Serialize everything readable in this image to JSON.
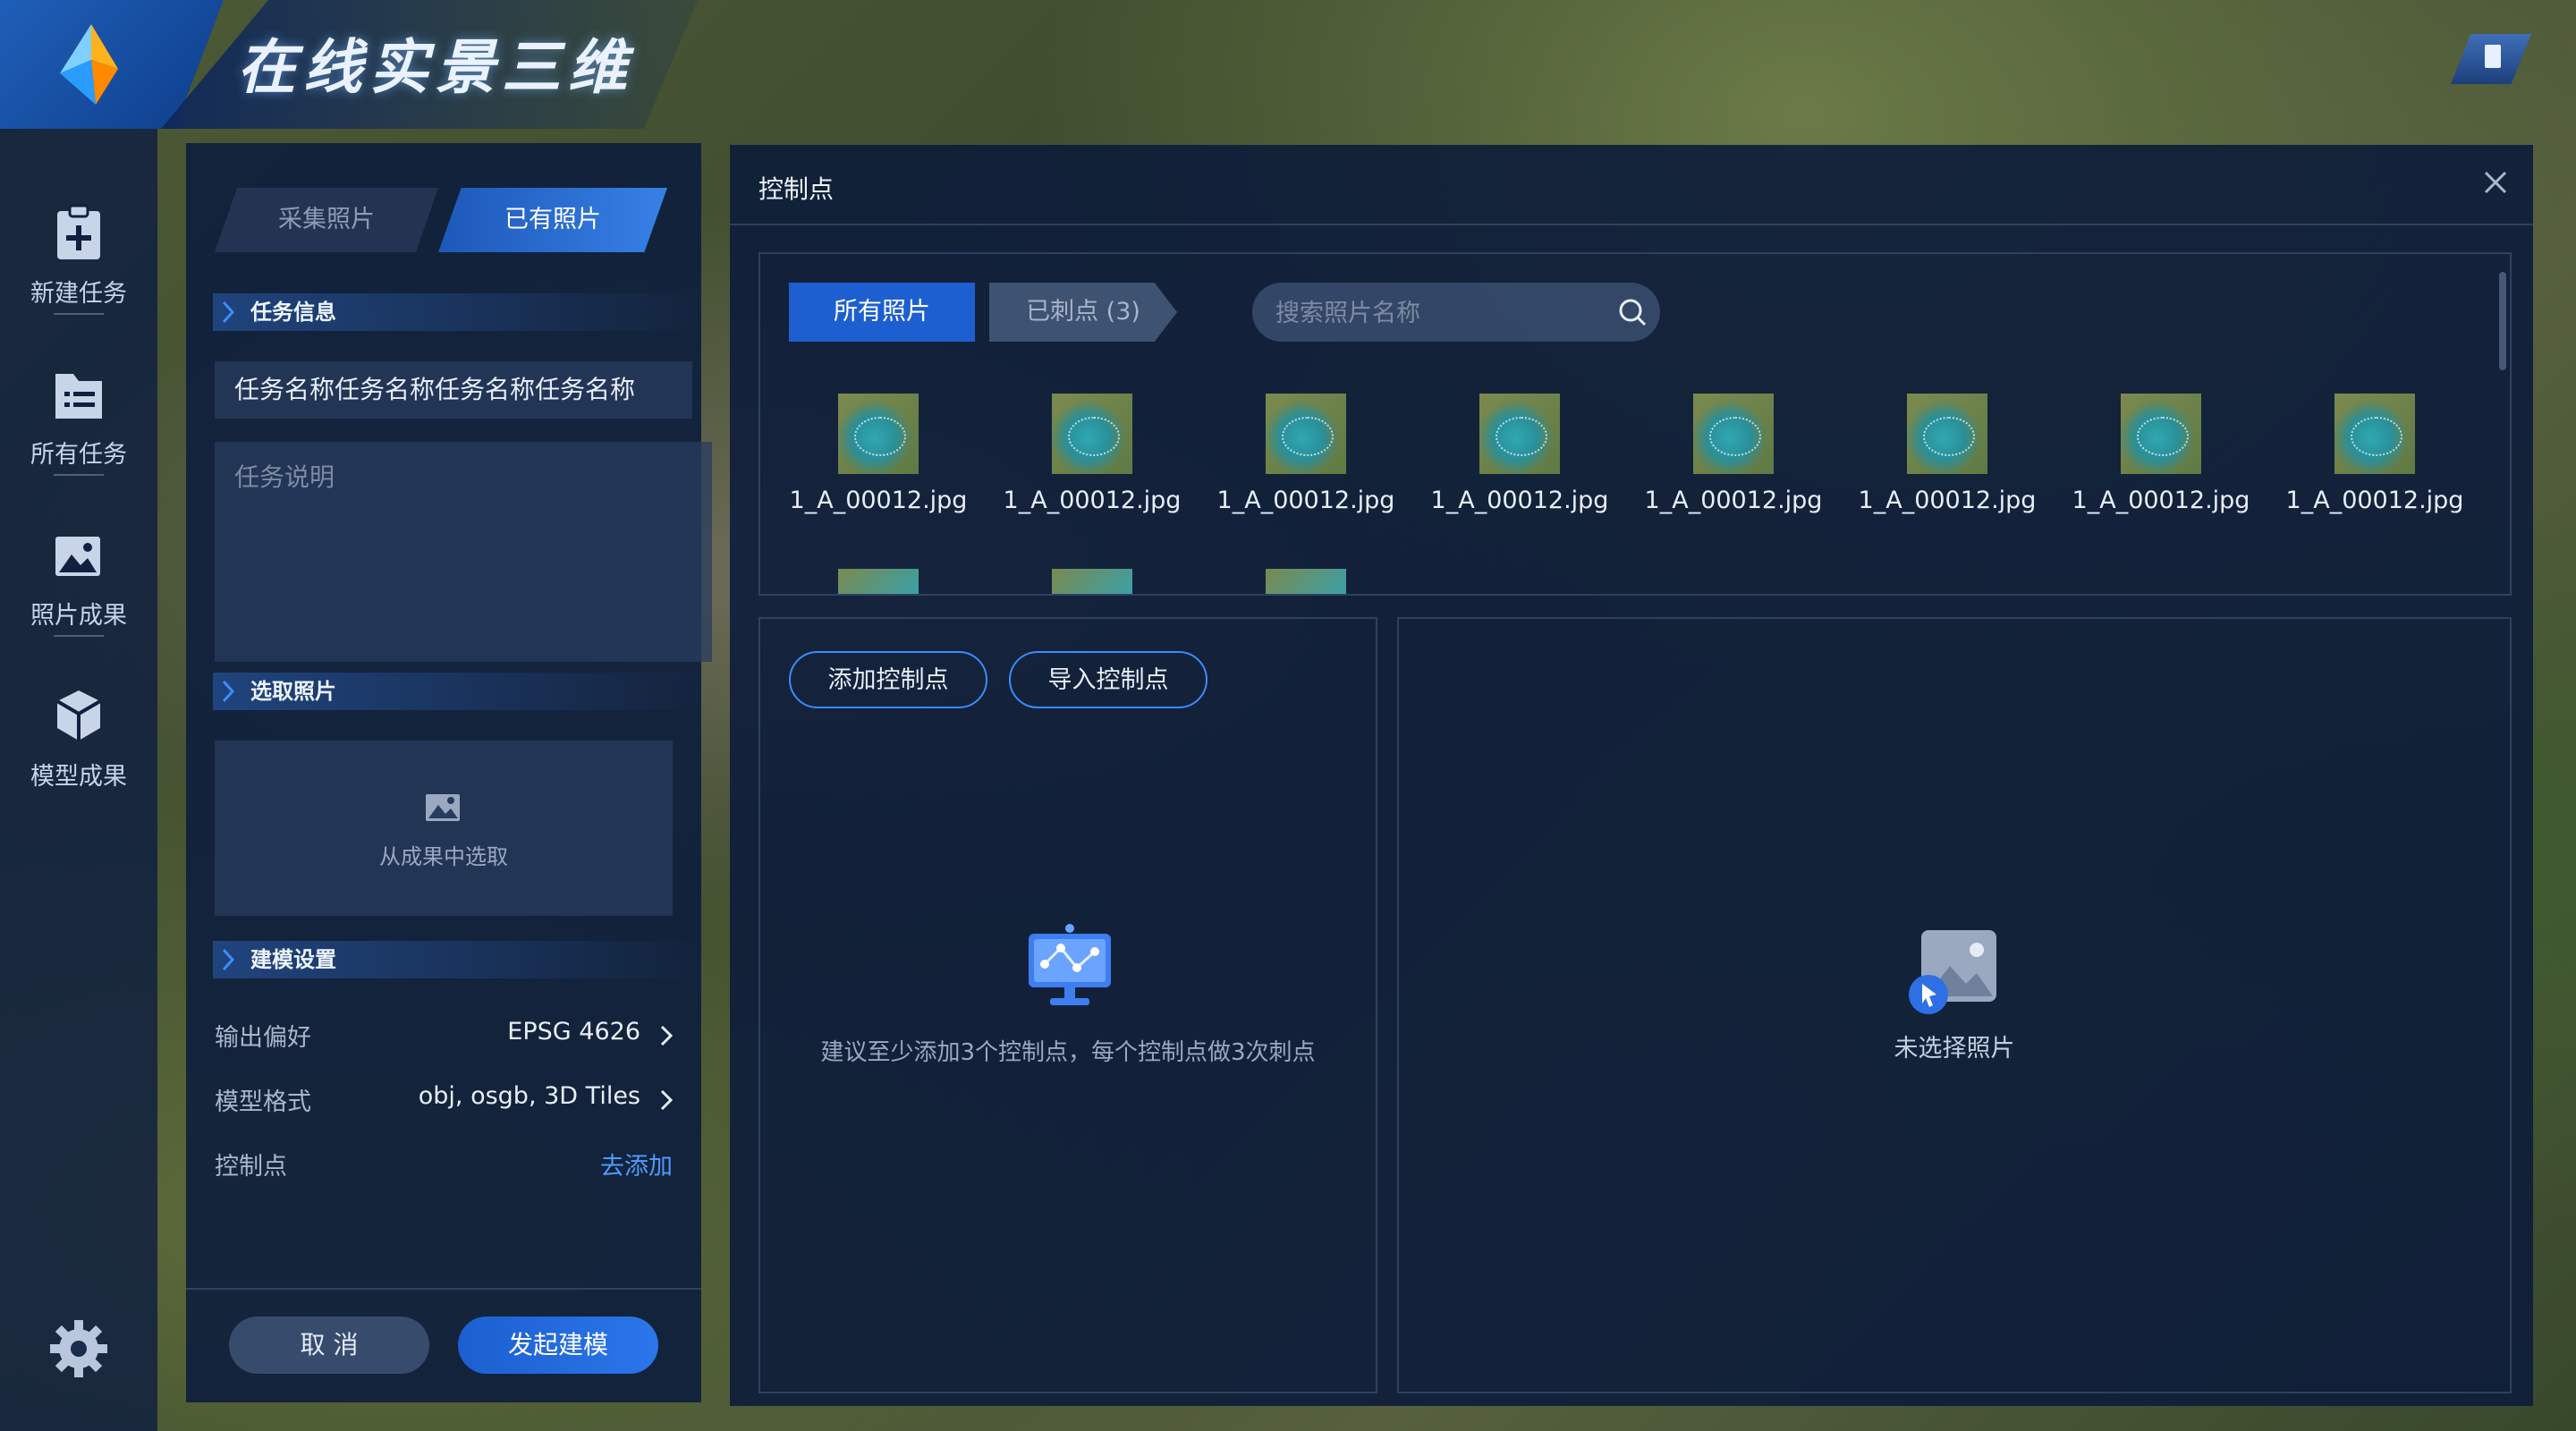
{
  "app": {
    "title": "在线实景三维"
  },
  "nav": {
    "items": [
      {
        "label": "新建任务",
        "icon": "clipboard-plus-icon"
      },
      {
        "label": "所有任务",
        "icon": "folder-list-icon"
      },
      {
        "label": "照片成果",
        "icon": "photo-result-icon"
      },
      {
        "label": "模型成果",
        "icon": "cube-icon"
      }
    ],
    "settings_icon": "gear-icon"
  },
  "task_panel": {
    "tabs": {
      "collect": "采集照片",
      "existing": "已有照片"
    },
    "section_task_info": "任务信息",
    "task_name": "任务名称任务名称任务名称任务名称",
    "task_desc_placeholder": "任务说明",
    "section_select_photos": "选取照片",
    "picker_label": "从成果中选取",
    "section_model_settings": "建模设置",
    "output_pref": {
      "label": "输出偏好",
      "value": "EPSG 4626"
    },
    "model_format": {
      "label": "模型格式",
      "value": "obj, osgb, 3D Tiles"
    },
    "control_points": {
      "label": "控制点",
      "link": "去添加"
    },
    "buttons": {
      "cancel": "取 消",
      "start": "发起建模"
    }
  },
  "dialog": {
    "title": "控制点",
    "tabs": {
      "all": "所有照片",
      "marked": "已刺点 (3)"
    },
    "search_placeholder": "搜索照片名称",
    "photos": [
      "1_A_00012.jpg",
      "1_A_00012.jpg",
      "1_A_00012.jpg",
      "1_A_00012.jpg",
      "1_A_00012.jpg",
      "1_A_00012.jpg",
      "1_A_00012.jpg",
      "1_A_00012.jpg"
    ],
    "buttons": {
      "add": "添加控制点",
      "import": "导入控制点"
    },
    "empty_hint": "建议至少添加3个控制点，每个控制点做3次刺点",
    "preview_empty": "未选择照片"
  },
  "colors": {
    "accent": "#1d5fd0",
    "link": "#4d9bff",
    "panel": "#0e1e3c"
  }
}
